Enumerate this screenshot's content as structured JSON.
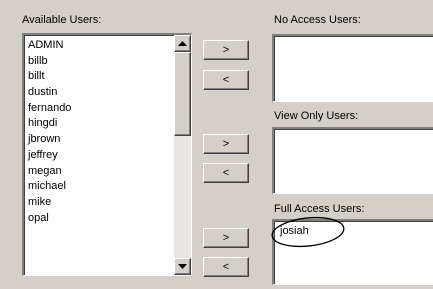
{
  "available_users": {
    "label": "Available Users:",
    "items": [
      "ADMIN",
      "billb",
      "billt",
      "dustin",
      "fernando",
      "hingdi",
      "jbrown",
      "jeffrey",
      "megan",
      "michael",
      "mike",
      "opal"
    ]
  },
  "no_access": {
    "label": "No Access Users:",
    "add_label": ">",
    "remove_label": "<"
  },
  "view_only": {
    "label": "View Only Users:",
    "add_label": ">",
    "remove_label": "<"
  },
  "full_access": {
    "label": "Full Access Users:",
    "add_label": ">",
    "remove_label": "<",
    "items": [
      "josiah"
    ]
  }
}
